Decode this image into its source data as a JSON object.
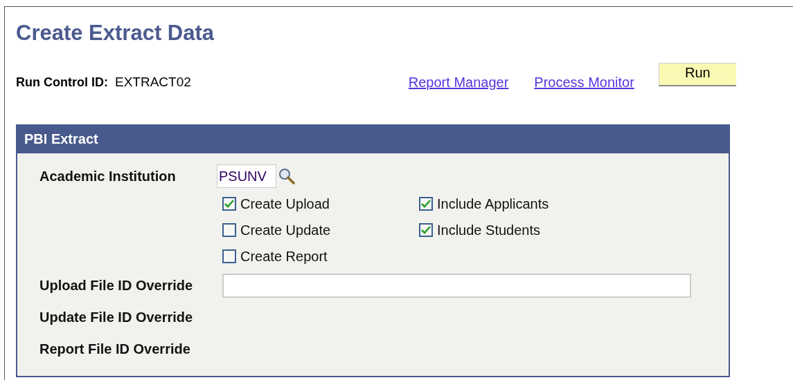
{
  "title": "Create Extract Data",
  "run_control": {
    "label": "Run Control ID:",
    "value": "EXTRACT02"
  },
  "links": [
    "Report Manager",
    "Process Monitor"
  ],
  "run_button": "Run",
  "panel": {
    "title": "PBI Extract",
    "institution": {
      "label": "Academic Institution",
      "value": "PSUNV"
    },
    "checkbox_columns": [
      [
        {
          "label": "Create Upload",
          "checked": true
        },
        {
          "label": "Create Update",
          "checked": false
        },
        {
          "label": "Create Report",
          "checked": false
        }
      ],
      [
        {
          "label": "Include Applicants",
          "checked": true
        },
        {
          "label": "Include Students",
          "checked": true
        }
      ]
    ],
    "overrides": [
      {
        "label": "Upload File ID Override",
        "kind": "field"
      },
      {
        "label": "Update File ID Override",
        "kind": "plain"
      },
      {
        "label": "Report File ID Override",
        "kind": "plain"
      }
    ]
  }
}
